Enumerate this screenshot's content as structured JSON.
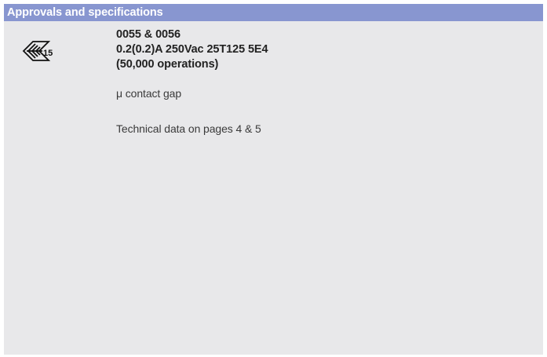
{
  "section": {
    "title": "Approvals and specifications"
  },
  "approval_mark": {
    "icon": "enec-approval-mark-icon",
    "number": "15"
  },
  "specifications": {
    "lines": [
      "0055 & 0056",
      "0.2(0.2)A 250Vac 25T125 5E4",
      "(50,000 operations)"
    ],
    "contact_gap": "μ contact gap",
    "technical_data": "Technical data on pages 4 & 5"
  },
  "colors": {
    "header_background": "#8896d0",
    "panel_background": "#e8e8ea"
  }
}
